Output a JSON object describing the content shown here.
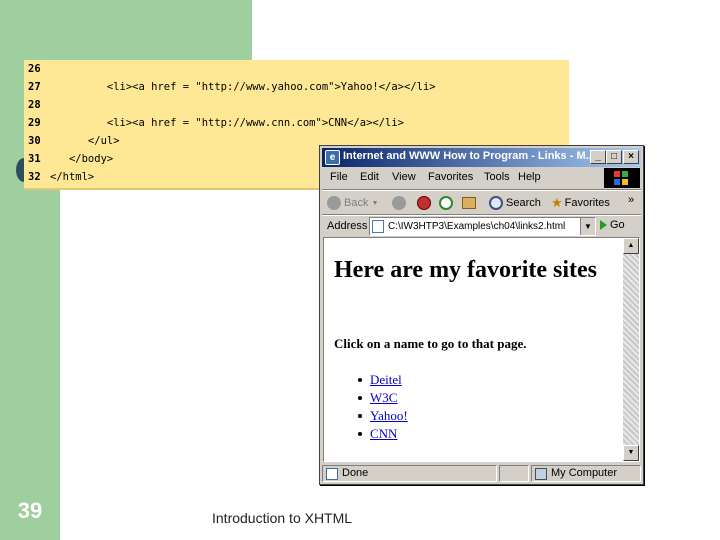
{
  "slide": {
    "number": "39",
    "footer": "Introduction to XHTML"
  },
  "code": {
    "lines": [
      {
        "num": "26",
        "text": ""
      },
      {
        "num": "27",
        "text": "         <li><a href = \"http://www.yahoo.com\">Yahoo!</a></li>"
      },
      {
        "num": "28",
        "text": ""
      },
      {
        "num": "29",
        "text": "         <li><a href = \"http://www.cnn.com\">CNN</a></li>"
      },
      {
        "num": "30",
        "text": "      </ul>"
      },
      {
        "num": "31",
        "text": "   </body>"
      },
      {
        "num": "32",
        "text": "</html>"
      }
    ]
  },
  "browser": {
    "title": "Internet and WWW How to Program - Links - M...",
    "menu": [
      "File",
      "Edit",
      "View",
      "Favorites",
      "Tools",
      "Help"
    ],
    "toolbar": {
      "back": "Back",
      "search": "Search",
      "favorites": "Favorites",
      "chevron": "»"
    },
    "address": {
      "label": "Address",
      "value": "C:\\IW3HTP3\\Examples\\ch04\\links2.html",
      "go": "Go"
    },
    "page": {
      "heading": "Here are my favorite sites",
      "paragraph": "Click on a name to go to that page.",
      "links": [
        "Deitel",
        "W3C",
        "Yahoo!",
        "CNN"
      ]
    },
    "status": {
      "left": "Done",
      "zone": "My Computer"
    },
    "colors": {
      "titlebar_start": "#0a246a",
      "titlebar_end": "#a6caf0",
      "link": "#0000cc",
      "chrome": "#d4d0c8"
    }
  }
}
